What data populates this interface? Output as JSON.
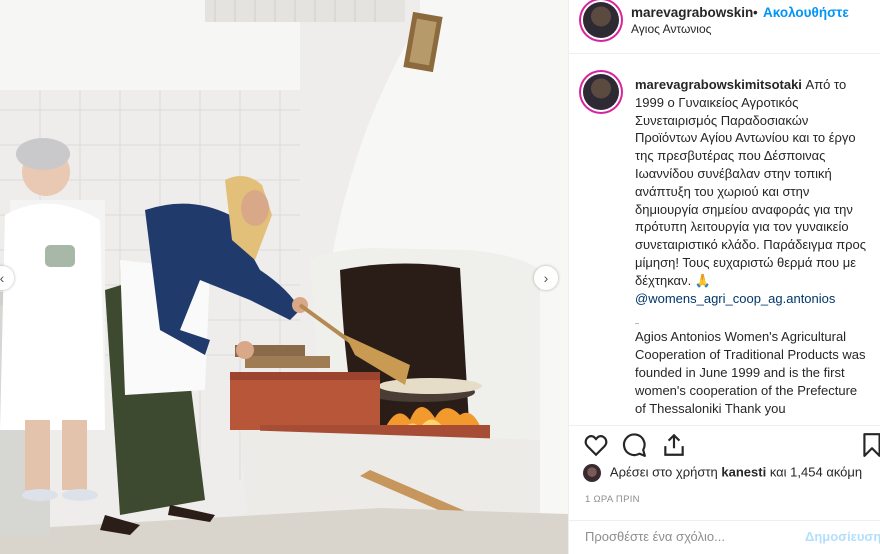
{
  "header": {
    "username": "marevagrabowskin",
    "dot": "•",
    "follow_label": "Ακολουθήστε",
    "location": "Αγιος Αντωνιος"
  },
  "caption": {
    "username": "marevagrabowskimitsotaki",
    "text_greek": "Από το 1999 ο Γυναικείος Αγροτικός Συνεταιρισμός Παραδοσιακών Προϊόντων Αγίου Αντωνίου και το έργο της πρεσβυτέρας που Δέσποινας Ιωαννίδου συνέβαλαν στην τοπική ανάπτυξη του χωριού και στην δημιουργία σημείου αναφοράς για την πρότυπη λειτουργία για τον γυναικείο συνεταιριστικό κλάδο. Παράδειγμα προς μίμηση! Τους ευχαριστώ θερμά που με δέχτηκαν. 🙏",
    "mention": "@womens_agri_coop_ag.antonios",
    "text_english": "Agios Antonios Women's Agricultural Cooperation of Traditional Products was founded in June 1999 and is the first women's cooperation of the Prefecture of Thessaloniki Thank you"
  },
  "actions": {
    "icons": [
      "heart-icon",
      "comment-icon",
      "share-icon",
      "bookmark-icon"
    ]
  },
  "likes": {
    "prefix": "Αρέσει στο χρήστη",
    "user": "kanesti",
    "suffix": "και 1,454 ακόμη"
  },
  "timestamp": "1 ΩΡΑ ΠΡΙΝ",
  "comment": {
    "placeholder": "Προσθέστε ένα σχόλιο...",
    "post_label": "Δημοσίευση"
  },
  "carousel": {
    "prev_icon": "chevron-left-icon",
    "next_icon": "chevron-right-icon"
  }
}
